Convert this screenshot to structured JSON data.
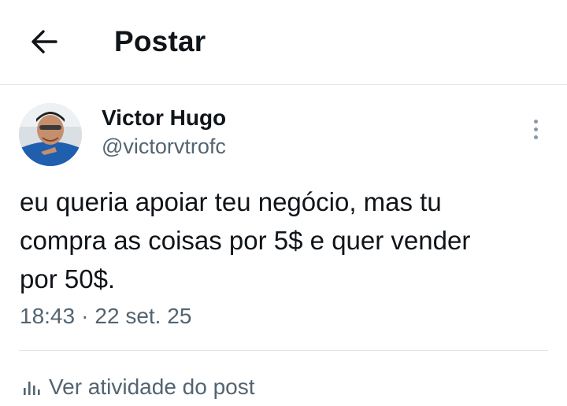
{
  "header": {
    "back_icon": "arrow-left-icon",
    "title": "Postar"
  },
  "post": {
    "author": {
      "display_name": "Victor Hugo",
      "handle": "@victorvtrofc",
      "avatar": "profile-photo"
    },
    "more_icon": "vertical-ellipsis-icon",
    "text": "eu queria apoiar teu negócio, mas tu\ncompra as coisas por 5$ e quer vender\npor 50$.",
    "time": "18:43",
    "separator": "·",
    "date": "22 set. 25"
  },
  "footer": {
    "activity_icon": "bar-chart-icon",
    "activity_label": "Ver atividade do post"
  },
  "colors": {
    "text_primary": "#0f1419",
    "text_secondary": "#536471",
    "divider": "#e1e6ea"
  }
}
